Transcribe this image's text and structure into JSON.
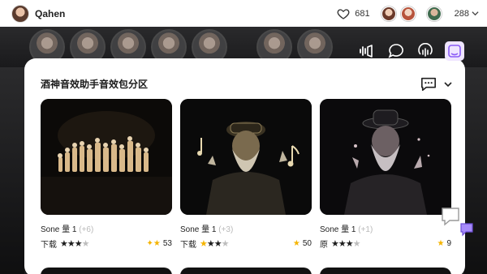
{
  "topbar": {
    "username": "Qahen",
    "likes": "681",
    "count": "288"
  },
  "panel": {
    "title": "酒神音效助手音效包分区"
  },
  "cards": [
    {
      "name": "Sone 量 1",
      "sub": "(+6)",
      "label": "下载",
      "stars_on": 3,
      "stars_off": 1,
      "rating": "53"
    },
    {
      "name": "Sone 量 1",
      "sub": "(+3)",
      "label": "下载",
      "stars_on": 3,
      "stars_off": 1,
      "rating": "50"
    },
    {
      "name": "Sone 量 1",
      "sub": "(+1)",
      "label": "原",
      "stars_on": 3,
      "stars_off": 1,
      "rating": "9"
    }
  ],
  "colors": {
    "accent": "#8b5cf6",
    "star": "#f5b400",
    "panel": "#ffffff",
    "background": "#1c1c1e"
  },
  "icons": [
    "heart-icon",
    "chevron-down-icon",
    "sound-icon",
    "chat-icon",
    "podcast-icon",
    "music-icon",
    "comment-icon",
    "star-icon"
  ]
}
